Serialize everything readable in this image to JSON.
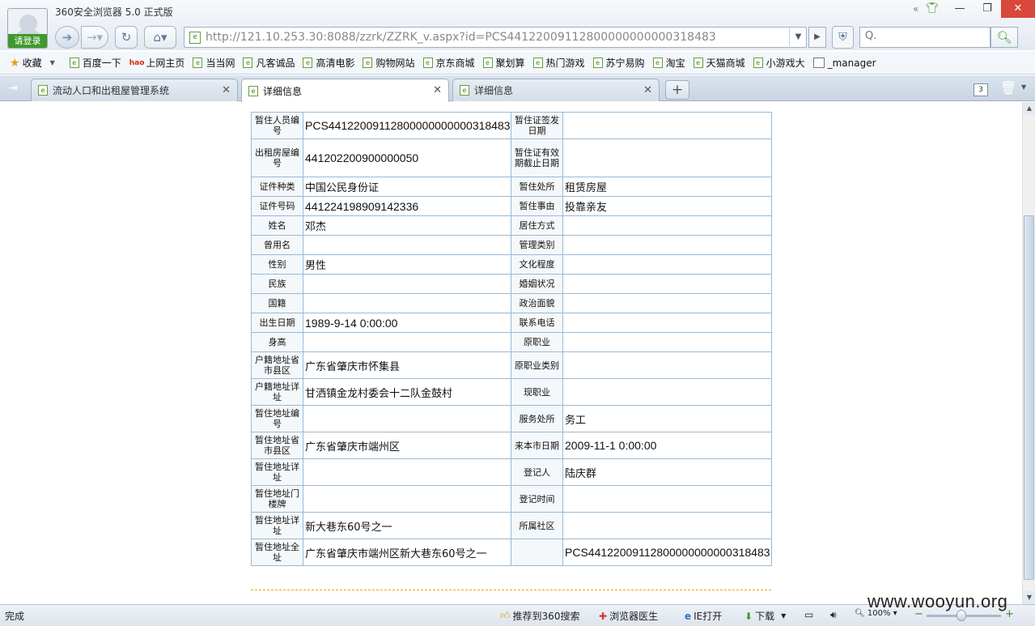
{
  "window": {
    "title": "360安全浏览器 5.0 正式版",
    "login_label": "请登录",
    "controls": {
      "minimize": "—",
      "restore": "❐",
      "close": "✕"
    },
    "skin_label": "«"
  },
  "nav": {
    "url": "http://121.10.253.30:8088/zzrk/ZZRK_v.aspx?id=PCS44122009112800000000000318483",
    "search_placeholder": "",
    "search_prefix": "Q."
  },
  "bookmarks": {
    "favorites_label": "收藏",
    "items": [
      "百度一下",
      "上网主页",
      "当当网",
      "凡客诚品",
      "高清电影",
      "购物网站",
      "京东商城",
      "聚划算",
      "热门游戏",
      "苏宁易购",
      "淘宝",
      "天猫商城",
      "小游戏大",
      "_manager"
    ],
    "hao_badge": "hao"
  },
  "tabs": [
    {
      "label": "流动人口和出租屋管理系统",
      "active": false
    },
    {
      "label": "详细信息",
      "active": true
    },
    {
      "label": "详细信息",
      "active": false
    }
  ],
  "tab_count": "3",
  "record": {
    "rows": [
      [
        "暂住人员编号",
        "PCS44122009112800000000000318483",
        "暂住证签发日期",
        ""
      ],
      [
        "出租房屋编号",
        "441202200900000050",
        "暂住证有效期截止日期",
        ""
      ],
      [
        "证件种类",
        "中国公民身份证",
        "暂住处所",
        "租赁房屋"
      ],
      [
        "证件号码",
        "441224198909142336",
        "暂住事由",
        "投靠亲友"
      ],
      [
        "姓名",
        "邓杰",
        "居住方式",
        ""
      ],
      [
        "曾用名",
        "",
        "管理类别",
        ""
      ],
      [
        "性别",
        "男性",
        "文化程度",
        ""
      ],
      [
        "民族",
        "",
        "婚姻状况",
        ""
      ],
      [
        "国籍",
        "",
        "政治面貌",
        ""
      ],
      [
        "出生日期",
        "1989-9-14 0:00:00",
        "联系电话",
        ""
      ],
      [
        "身高",
        "",
        "原职业",
        ""
      ],
      [
        "户籍地址省市县区",
        "广东省肇庆市怀集县",
        "原职业类别",
        ""
      ],
      [
        "户籍地址详址",
        "甘洒镇金龙村委会十二队金鼓村",
        "现职业",
        ""
      ],
      [
        "暂住地址编号",
        "",
        "服务处所",
        "务工"
      ],
      [
        "暂住地址省市县区",
        "广东省肇庆市端州区",
        "来本市日期",
        "2009-11-1 0:00:00"
      ],
      [
        "暂住地址详址",
        "",
        "登记人",
        "陆庆群"
      ],
      [
        "暂住地址门楼牌",
        "",
        "登记时间",
        ""
      ],
      [
        "暂住地址详址",
        "新大巷东60号之一",
        "所属社区",
        ""
      ],
      [
        "暂住地址全址",
        "广东省肇庆市端州区新大巷东60号之一",
        "",
        "PCS44122009112800000000000318483"
      ]
    ]
  },
  "status": {
    "text": "完成",
    "items": [
      "推荐到360搜索",
      "浏览器医生",
      "IE打开",
      "下载"
    ],
    "zoom": "100%",
    "watermark": "www.wooyun.org"
  },
  "colors": {
    "accent": "#3f9a2b",
    "border": "#99b9d6",
    "dash": "#e6a320"
  }
}
